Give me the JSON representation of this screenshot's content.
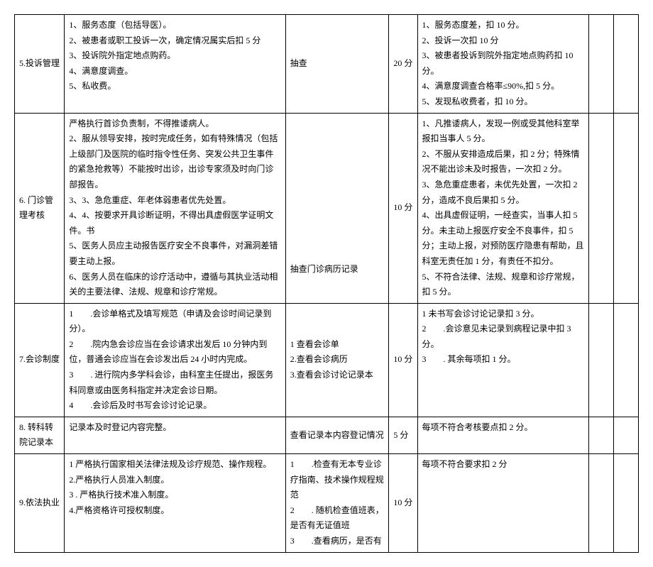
{
  "rows": [
    {
      "name": "5.投诉管理",
      "content": "1、服务态度（包括导医）。\n2、被患者或职工投诉一次，确定情况属实后扣 5 分\n3、投诉院外指定地点购药。\n4、满意度调查。\n5、私收费。",
      "method": "抽查",
      "score": "20 分",
      "deduction": "1、服务态度差，扣 10 分。\n2、投诉一次扣 10 分\n3、被患者投诉到院外指定地点购药扣 10 分。\n4、满意度调查合格率≤90%,扣 5 分。\n5、发现私收费者，扣 10 分。"
    },
    {
      "name": "6. 门诊管理考核",
      "content": "严格执行首诊负责制，不得推诿病人。\n2、服从领导安排，按时完成任务，如有特殊情况（包括上级部门及医院的临时指令性任务、突发公共卫生事件的紧急抢救等）不能按时出诊，出诊专家须及时向门诊部报告。\n3、3、急危重症、年老体弱患者优先处置。\n4、4、按要求开具诊断证明，不得出具虚假医学证明文件。书\n5、医务人员应主动报告医疗安全不良事件，对漏洞差错要主动上报。\n6、医务人员在临床的诊疗活动中，遵循与其执业活动相关的主要法律、法规、规章和诊疗常规。",
      "method": "\n\n\n\n\n\n\n\n抽查门诊病历记录",
      "score": "10 分",
      "deduction": "1、凡推诿病人，发现一例或受其他科室举报扣当事人 5 分。\n2、不服从安排造成后果，扣 2 分；特殊情况不能出诊未及时报告，一次扣 2 分。\n3、急危重症患者，未优先处置，一次扣 2 分，造成不良后果扣 5 分。\n4、出具虚假证明，一经查实，当事人扣 5 分。未主动上报医疗安全不良事件，扣 5 分；主动上报，对预防医疗隐患有帮助，且科室无责任加 1 分，有责任不扣分。\n5、不符合法律、法规、规章和诊疗常规，扣 5 分。"
    },
    {
      "name": "7.会诊制度",
      "content": "1　　.会诊单格式及填写规范（申请及会诊时间记录到分）。\n2　　.院内急会诊应当在会诊请求出发后 10 分钟内到位，普通会诊应当在会诊发出后 24 小时内完成。\n3　　. 进行院内多学科会诊，由科室主任提出，报医务科同意或由医务科指定并决定会诊日期。\n4　　.会诊后及时书写会诊讨论记录。",
      "method": "1 查看会诊单\n2.查看会诊病历\n3.查看会诊讨论记录本",
      "score": "10 分",
      "deduction": "1 未书写会诊讨论记录扣 3 分。\n2　　.会诊意见未记录到病程记录中扣 3 分。\n3　　. 其余每项扣 1 分。"
    },
    {
      "name": "8. 转科转院记录本",
      "content": "记录本及时登记内容完整。",
      "method": "查看记录本内容登记情况",
      "score": "5 分",
      "deduction": "每项不符合考核要点扣 2 分。"
    },
    {
      "name": "\n\n\n\n9.依法执业",
      "content": "1 严格执行国家相关法律法规及诊疗规范、操作规程。\n2.严格执行人员准入制度。\n3 . 严格执行技术准入制度。\n4.严格资格许可授权制度。",
      "method": "1　　.检查有无本专业诊疗指南、技术操作规程规范\n2　　. 随机检查值班表，是否有无证值班\n3　　.查看病历，是否有",
      "score": "10 分",
      "deduction": "每项不符合要求扣 2 分"
    }
  ]
}
